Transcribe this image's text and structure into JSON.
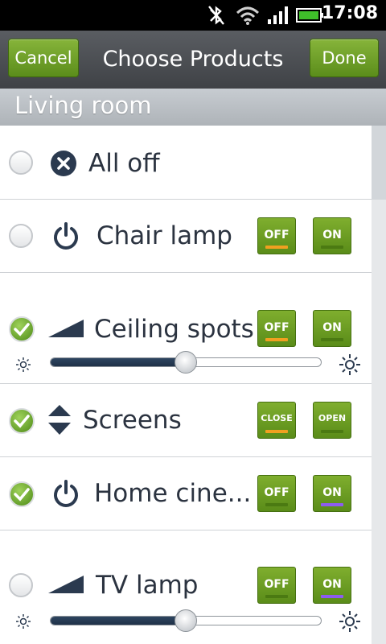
{
  "status_bar": {
    "time": "17:08"
  },
  "title_bar": {
    "cancel_label": "Cancel",
    "title": "Choose Products",
    "done_label": "Done"
  },
  "section": {
    "title": "Living room"
  },
  "devices": [
    {
      "name": "All off",
      "selected": false,
      "icon": "x-circle-icon"
    },
    {
      "name": "Chair lamp",
      "selected": false,
      "icon": "power-icon",
      "off_label": "OFF",
      "on_label": "ON",
      "state": "off"
    },
    {
      "name": "Ceiling spots",
      "selected": true,
      "icon": "dimmer-icon",
      "off_label": "OFF",
      "on_label": "ON",
      "state": "off",
      "level_percent": 50
    },
    {
      "name": "Screens",
      "selected": true,
      "icon": "up-down-icon",
      "off_label": "CLOSE",
      "on_label": "OPEN",
      "state": "close"
    },
    {
      "name": "Home cine...",
      "selected": true,
      "icon": "power-icon",
      "off_label": "OFF",
      "on_label": "ON",
      "state": "on"
    },
    {
      "name": "TV lamp",
      "selected": false,
      "icon": "dimmer-icon",
      "off_label": "OFF",
      "on_label": "ON",
      "state": "on",
      "level_percent": 50
    }
  ],
  "colors": {
    "accent_green": "#6a9d22",
    "off_indicator": "#f0a020",
    "on_indicator": "#8d5cf0",
    "icon_dark": "#2b3a4f"
  }
}
